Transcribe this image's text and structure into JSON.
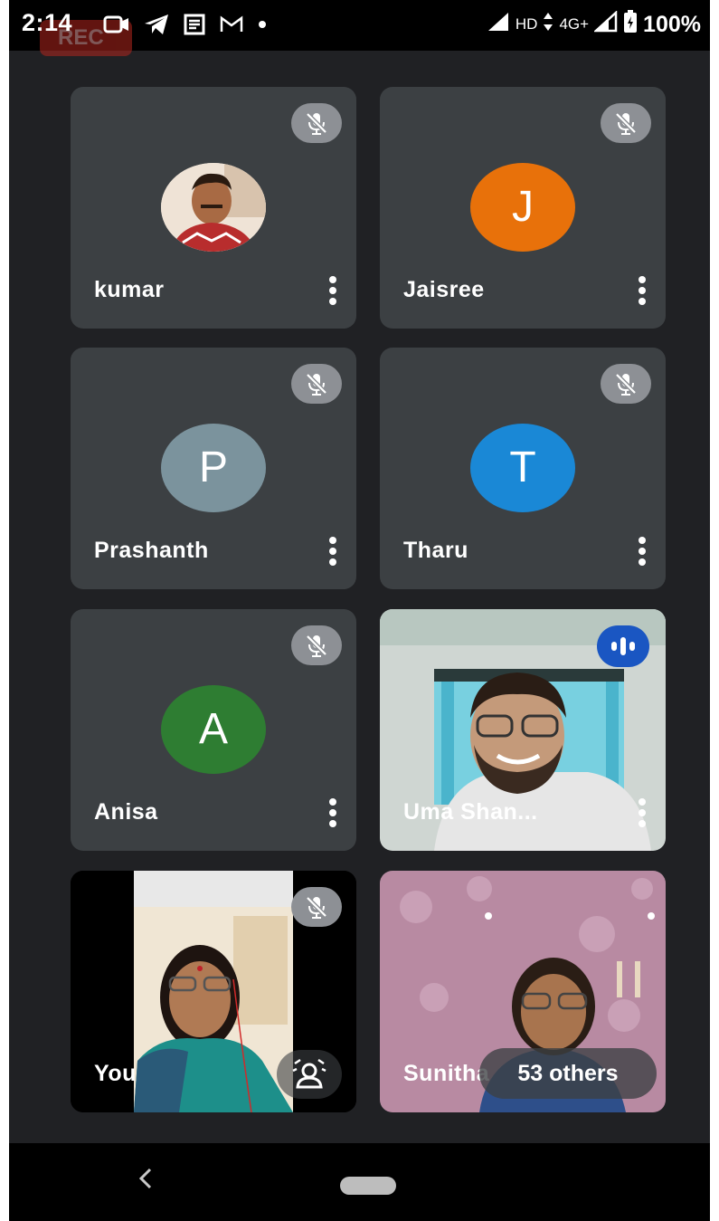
{
  "status_bar": {
    "time": "2:14",
    "rec_label": "REC",
    "network_hd": "HD",
    "network_type": "4G+",
    "battery": "100%",
    "left_icons": [
      "video-icon",
      "telegram-icon",
      "news-icon",
      "gmail-icon",
      "dot-icon"
    ]
  },
  "participants": [
    {
      "name": "kumar",
      "avatar_type": "photo",
      "muted": true
    },
    {
      "name": "Jaisree",
      "avatar_letter": "J",
      "avatar_color": "#e8710a",
      "muted": true
    },
    {
      "name": "Prashanth",
      "avatar_letter": "P",
      "avatar_color": "#7b939d",
      "muted": true
    },
    {
      "name": "Tharu",
      "avatar_letter": "T",
      "avatar_color": "#1a88d6",
      "muted": true
    },
    {
      "name": "Anisa",
      "avatar_letter": "A",
      "avatar_color": "#2e7d32",
      "muted": true
    },
    {
      "name": "Uma Shan...",
      "video": true,
      "speaking": true
    },
    {
      "name": "You",
      "video": true,
      "muted": true,
      "self": true
    },
    {
      "name": "Sunitha",
      "video": true
    }
  ],
  "others_label": "53 others",
  "nav": {
    "back_icon": "back-arrow-icon",
    "home_icon": "home-pill-icon"
  }
}
